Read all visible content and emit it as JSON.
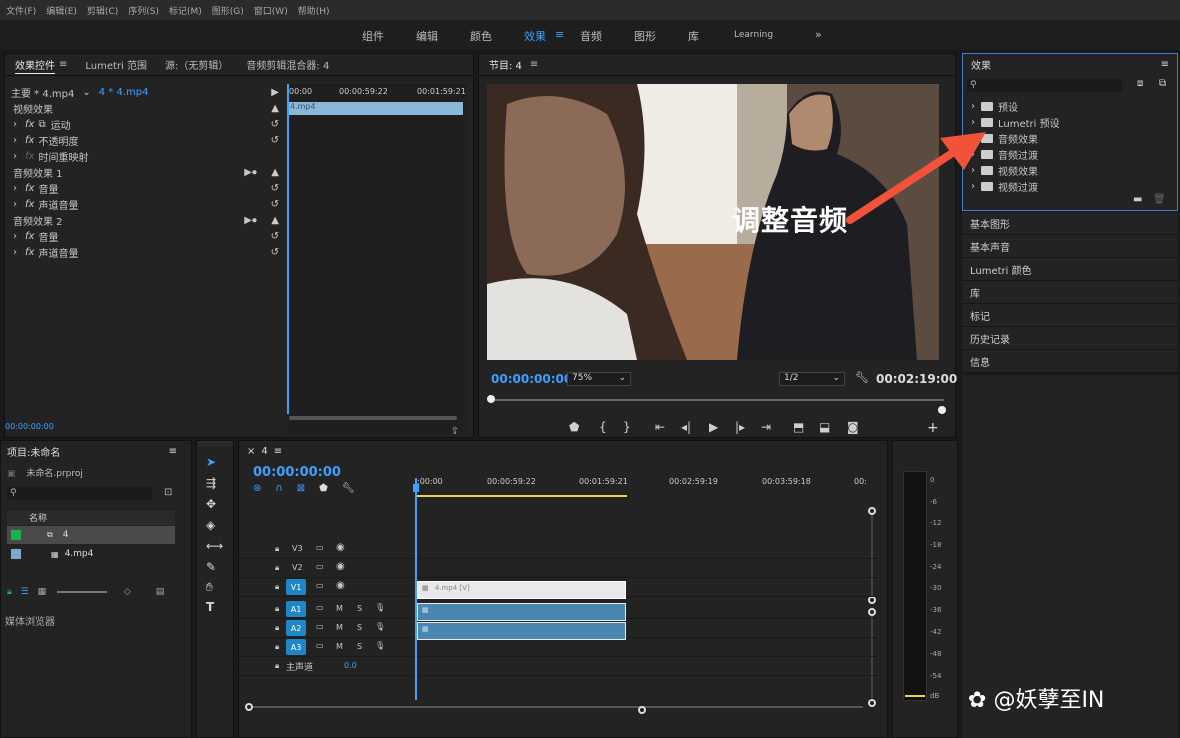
{
  "menu": [
    "文件(F)",
    "编辑(E)",
    "剪辑(C)",
    "序列(S)",
    "标记(M)",
    "图形(G)",
    "窗口(W)",
    "帮助(H)"
  ],
  "workspaces": [
    "组件",
    "编辑",
    "颜色",
    "效果",
    "音频",
    "图形",
    "库",
    "Learning",
    "»"
  ],
  "active_workspace": "效果",
  "effect_controls": {
    "tabs": [
      "效果控件",
      "Lumetri 范围",
      "源:（无剪辑）",
      "音频剪辑混合器: 4"
    ],
    "source": "主要 * 4.mp4",
    "clip": "4 * 4.mp4",
    "ruler": [
      "00:00",
      "00:00:59:22",
      "00:01:59:21"
    ],
    "clip_label": "4.mp4",
    "sections": {
      "video": "视频效果",
      "motion": "运动",
      "opacity": "不透明度",
      "time_remap": "时间重映射",
      "audio1": "音频效果 1",
      "volume1": "音量",
      "channel1": "声道音量",
      "audio2": "音频效果 2",
      "volume2": "音量",
      "channel2": "声道音量"
    },
    "fx": "fx",
    "timecode": "00:00:00:00"
  },
  "program": {
    "title": "节目: 4",
    "overlay": "调整音频",
    "timecode": "00:00:00:00",
    "zoom": "75%",
    "resolution": "1/2",
    "duration": "00:02:19:00"
  },
  "effects_panel": {
    "title": "效果",
    "items": [
      "预设",
      "Lumetri 预设",
      "音频效果",
      "音频过渡",
      "视频效果",
      "视频过渡"
    ]
  },
  "right_panels": [
    "基本图形",
    "基本声音",
    "Lumetri 颜色",
    "库",
    "标记",
    "历史记录",
    "信息"
  ],
  "project": {
    "title": "项目:未命名",
    "file": "未命名.prproj",
    "column": "名称",
    "items": [
      "4",
      "4.mp4"
    ],
    "media_browser": "媒体浏览器"
  },
  "timeline": {
    "tab": "4",
    "timecode": "00:00:00:00",
    "ruler": [
      ":00:00",
      "00:00:59:22",
      "00:01:59:21",
      "00:02:59:19",
      "00:03:59:18",
      "00:"
    ],
    "video_tracks": [
      "V3",
      "V2",
      "V1"
    ],
    "audio_tracks": [
      "A1",
      "A2",
      "A3"
    ],
    "master": "主声道",
    "master_value": "0.0",
    "clip_video": "4.mp4 [V]",
    "btn_m": "M",
    "btn_s": "S"
  },
  "meter": [
    "0",
    "-6",
    "-12",
    "-18",
    "-24",
    "-30",
    "-36",
    "-42",
    "-48",
    "-54",
    "dB"
  ],
  "watermark": "@妖孽至IN",
  "colors": {
    "accent": "#3ea0ff",
    "arrow": "#f0523a",
    "clip_audio": "#4a86b0",
    "track_on": "#1f86c8"
  }
}
